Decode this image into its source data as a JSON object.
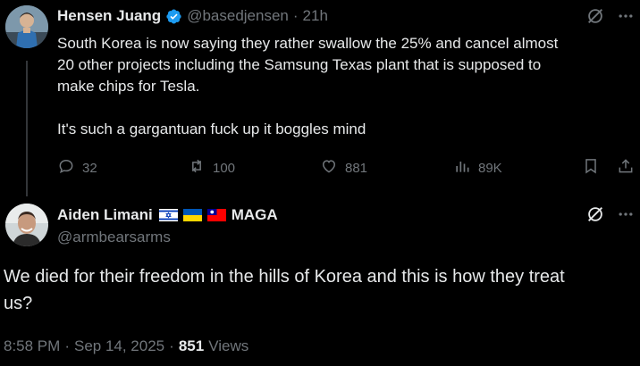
{
  "tweet1": {
    "author_name": "Hensen Juang",
    "handle": "@basedjensen",
    "separator": "·",
    "time": "21h",
    "text_line1": "South Korea is now saying they rather swallow the 25% and cancel almost",
    "text_line2": "20 other projects including the Samsung Texas plant that is supposed to",
    "text_line3": "make chips for Tesla.",
    "text_line4": "It's such a gargantuan fuck up it boggles mind",
    "replies": "32",
    "reposts": "100",
    "likes": "881",
    "views": "89K"
  },
  "tweet2": {
    "author_name": "Aiden Limani",
    "name_suffix": "MAGA",
    "handle": "@armbearsarms",
    "text_line1": "We died for their freedom in the hills of Korea and this is how they treat",
    "text_line2": "us?",
    "time": "8:58 PM",
    "dot1": "·",
    "date": "Sep 14, 2025",
    "dot2": "·",
    "views_count": "851",
    "views_label": "Views"
  },
  "icons": [
    "verified-badge-icon",
    "grok-icon",
    "more-icon",
    "reply-icon",
    "repost-icon",
    "like-icon",
    "views-icon",
    "bookmark-icon",
    "share-icon",
    "flag-israel",
    "flag-ukraine",
    "flag-taiwan"
  ],
  "colors": {
    "background": "#000000",
    "text": "#e7e9ea",
    "muted": "#71767b",
    "verified": "#1d9bf0"
  }
}
